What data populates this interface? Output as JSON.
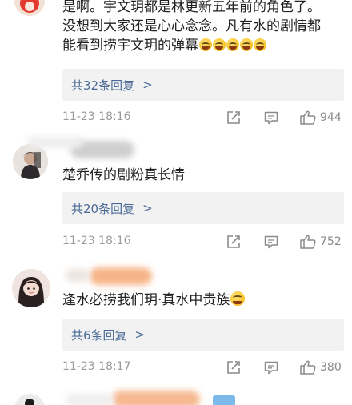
{
  "comments": [
    {
      "text_lines": [
        "是啊。宇文玥都是林更新五年前的角色了。",
        "没想到大家还是心心念念。凡有水的剧情都",
        "能看到捞宇文玥的弹幕"
      ],
      "emoji_count": 5,
      "replies_label": "共32条回复",
      "time": "11-23 18:16",
      "likes": "944"
    },
    {
      "text": "楚乔传的剧粉真长情",
      "replies_label": "共20条回复",
      "time": "11-23 18:16",
      "likes": "752"
    },
    {
      "text": "逢水必捞我们玥·真水中贵族",
      "replies_label": "共6条回复",
      "time": "11-23 18:17",
      "likes": "380"
    }
  ],
  "icons": {
    "share": "share-icon",
    "comment": "comment-icon",
    "like": "thumbs-up-icon",
    "chevron": "chevron-right-icon",
    "reply_chevron_glyph": ">"
  },
  "colors": {
    "text": "#222222",
    "meta": "#9a9a9a",
    "reply_link": "#4a6a96",
    "reply_bg": "#f2f2f2"
  }
}
